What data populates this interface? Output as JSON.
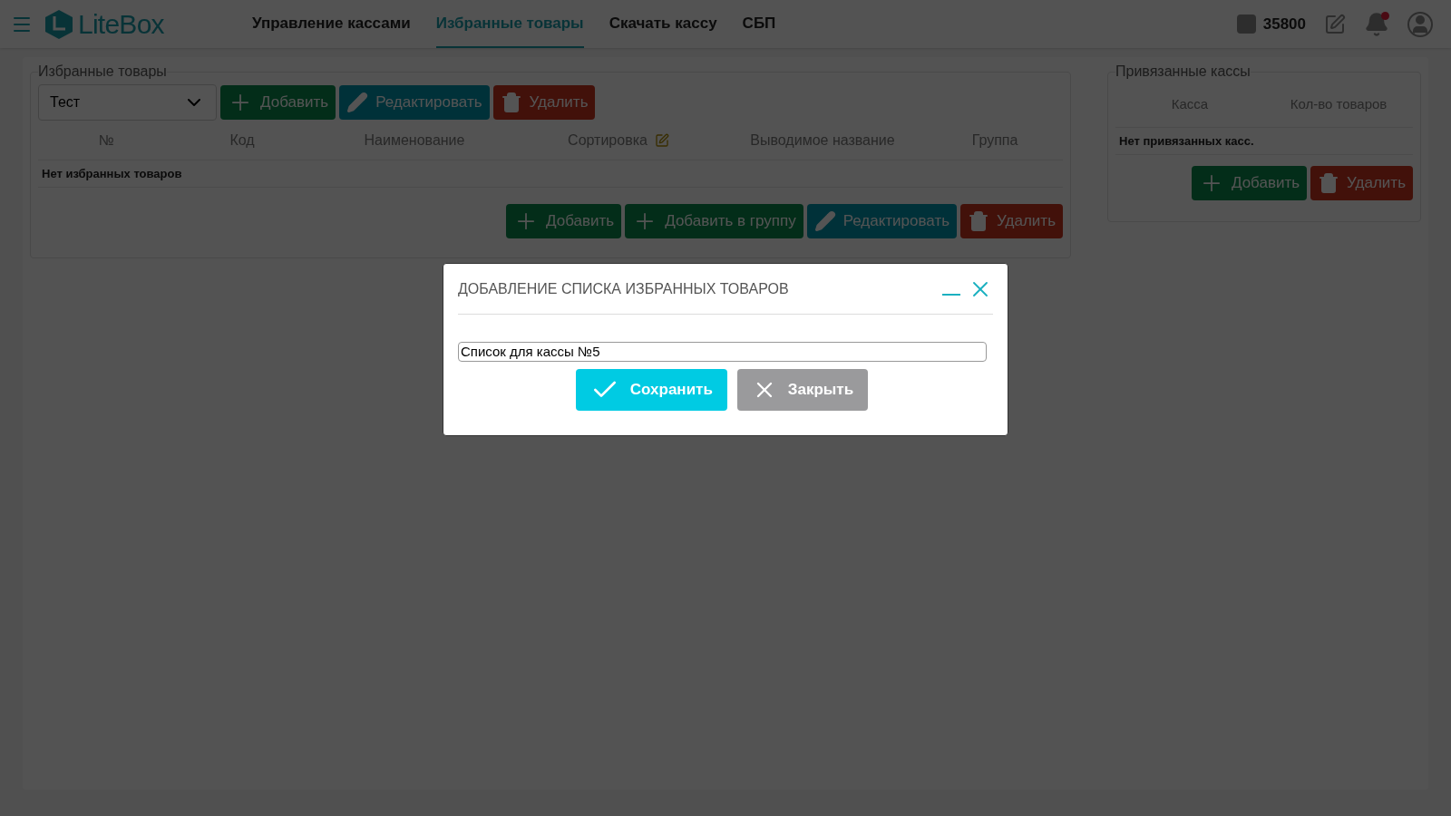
{
  "header": {
    "logo": "LiteBox",
    "nav": [
      {
        "label": "Управление кассами",
        "selected": false
      },
      {
        "label": "Избранные товары",
        "selected": true
      },
      {
        "label": "Скачать кассу",
        "selected": false
      },
      {
        "label": "СБП",
        "selected": false
      }
    ],
    "account_id": "35800",
    "has_notifications": true
  },
  "favorites": {
    "legend": "Избранные товары",
    "list_select": {
      "value": "Тест"
    },
    "toolbar": [
      {
        "kind": "add",
        "label": "Добавить"
      },
      {
        "kind": "edit",
        "label": "Редактировать"
      },
      {
        "kind": "delete",
        "label": "Удалить"
      }
    ],
    "columns": [
      "№",
      "Код",
      "Наименование",
      "Сортировка",
      "Выводимое название",
      "Группа"
    ],
    "empty_message": "Нет избранных товаров",
    "actions": [
      {
        "kind": "add",
        "label": "Добавить"
      },
      {
        "kind": "add",
        "label": "Добавить в группу"
      },
      {
        "kind": "edit",
        "label": "Редактировать"
      },
      {
        "kind": "delete",
        "label": "Удалить"
      }
    ]
  },
  "linked_registers": {
    "legend": "Привязанные кассы",
    "columns": [
      "Касса",
      "Кол-во товаров"
    ],
    "empty_message": "Нет привязанных касс.",
    "actions": [
      {
        "kind": "add",
        "label": "Добавить"
      },
      {
        "kind": "delete",
        "label": "Удалить"
      }
    ]
  },
  "dialog": {
    "title": "ДОБАВЛЕНИЕ СПИСКА ИЗБРАННЫХ ТОВАРОВ",
    "name_field": {
      "value": "Список для кассы №5"
    },
    "buttons": [
      {
        "kind": "save",
        "label": "Сохранить"
      },
      {
        "kind": "close",
        "label": "Закрыть"
      }
    ]
  }
}
